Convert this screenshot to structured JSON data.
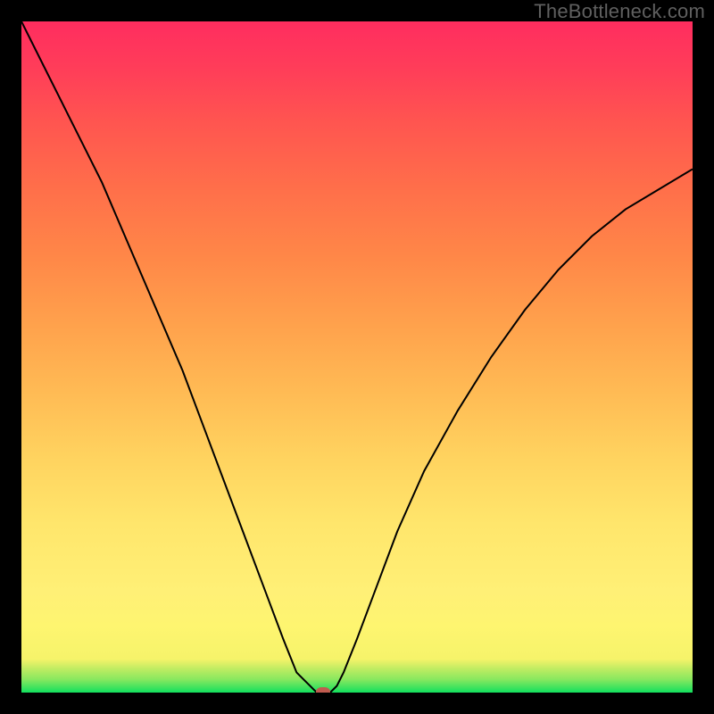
{
  "watermark": "TheBottleneck.com",
  "colors": {
    "frame": "#000000",
    "curve": "#000000",
    "marker": "#c05b4f",
    "gradient_top": "#ff2d5f",
    "gradient_mid": "#ffd35f",
    "gradient_bottom": "#12e05e"
  },
  "chart_data": {
    "type": "line",
    "title": "",
    "xlabel": "",
    "ylabel": "",
    "xlim": [
      0,
      100
    ],
    "ylim": [
      0,
      100
    ],
    "x": [
      0,
      3,
      6,
      9,
      12,
      15,
      18,
      21,
      24,
      27,
      30,
      33,
      36,
      39,
      41,
      43,
      44,
      45,
      46,
      47,
      48,
      50,
      53,
      56,
      60,
      65,
      70,
      75,
      80,
      85,
      90,
      95,
      100
    ],
    "values": [
      100,
      94,
      88,
      82,
      76,
      69,
      62,
      55,
      48,
      40,
      32,
      24,
      16,
      8,
      3,
      1,
      0,
      0,
      0,
      1,
      3,
      8,
      16,
      24,
      33,
      42,
      50,
      57,
      63,
      68,
      72,
      75,
      78
    ],
    "marker": {
      "x": 45,
      "y": 0
    },
    "annotations": []
  }
}
